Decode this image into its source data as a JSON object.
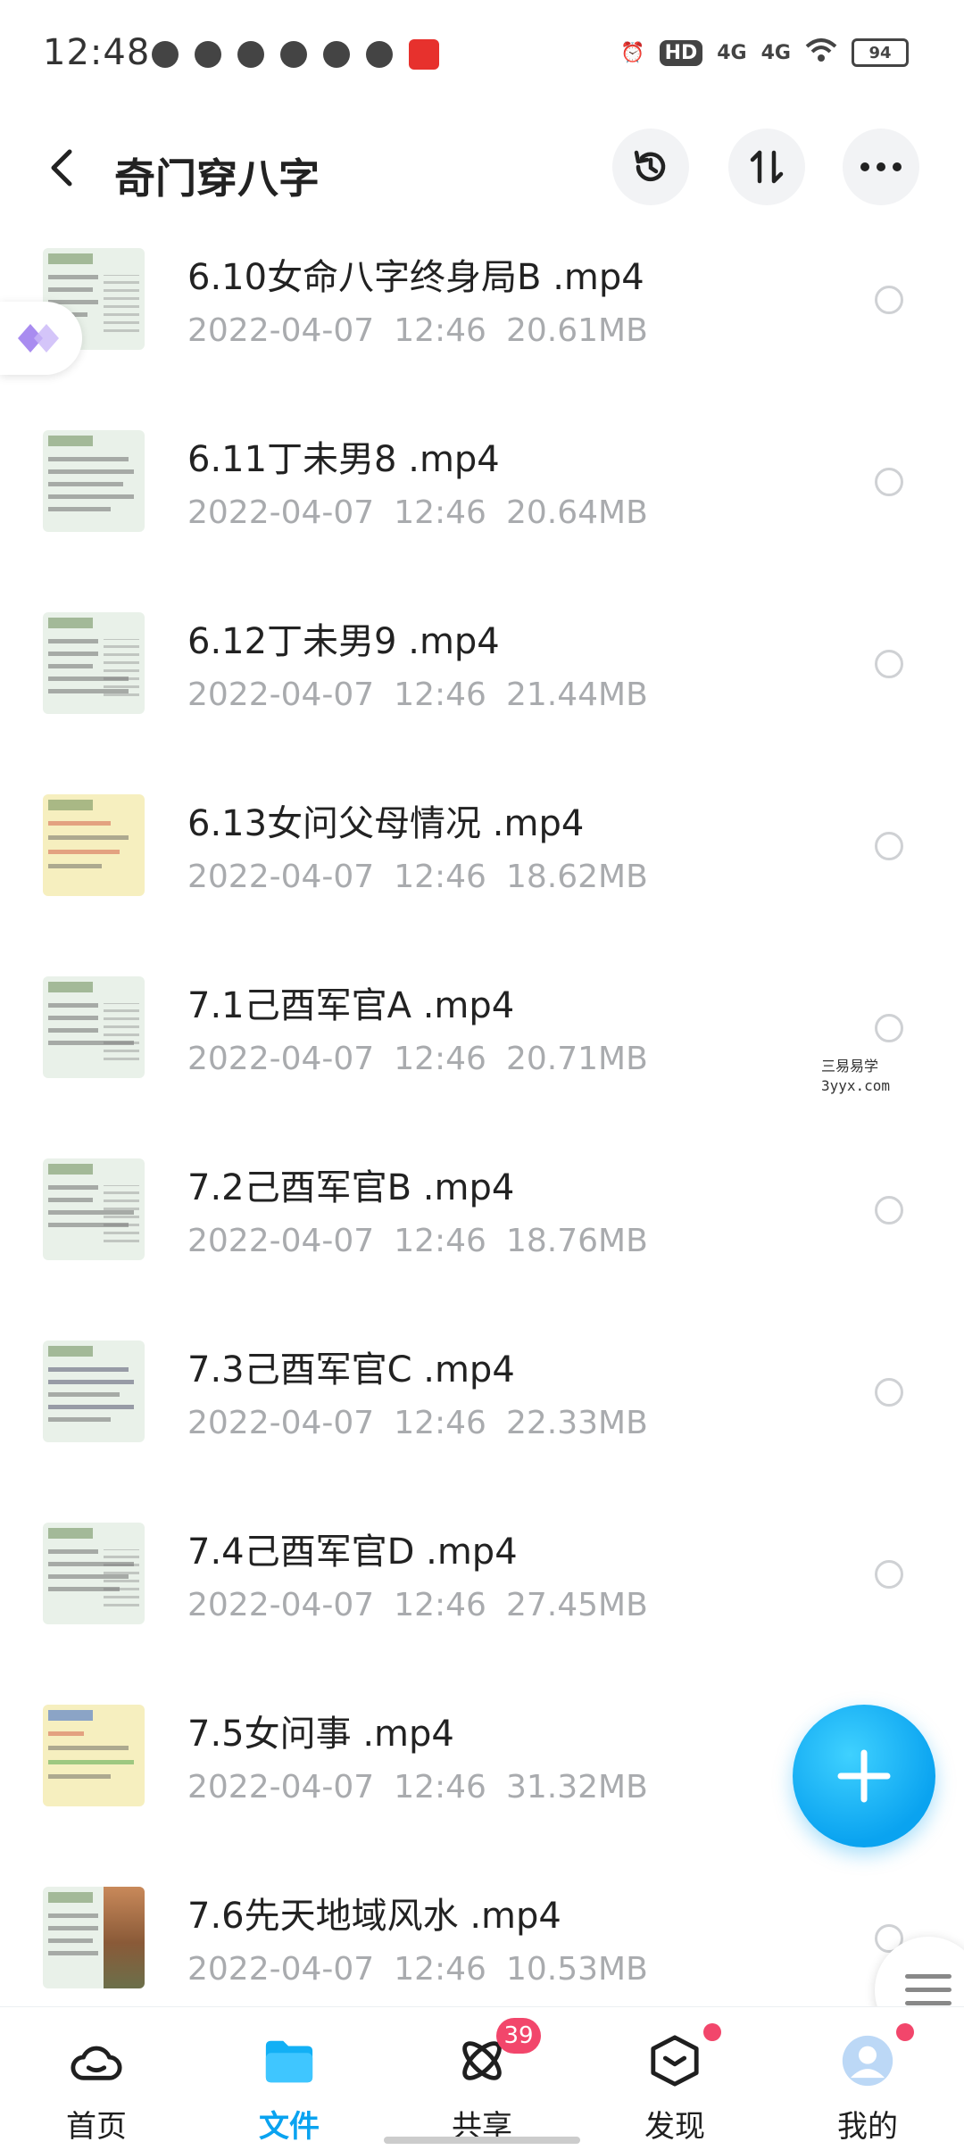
{
  "status_bar": {
    "time": "12:48",
    "hd_label": "HD",
    "network_1": "4G",
    "network_2": "4G",
    "battery": "94"
  },
  "header": {
    "title": "奇门穿八字"
  },
  "files": [
    {
      "name": "6.10女命八字终身局B .mp4",
      "date": "2022-04-07",
      "time": "12:46",
      "size": "20.61MB",
      "thumb": "green"
    },
    {
      "name": "6.11丁未男8 .mp4",
      "date": "2022-04-07",
      "time": "12:46",
      "size": "20.64MB",
      "thumb": "green"
    },
    {
      "name": "6.12丁未男9 .mp4",
      "date": "2022-04-07",
      "time": "12:46",
      "size": "21.44MB",
      "thumb": "green"
    },
    {
      "name": "6.13女问父母情况 .mp4",
      "date": "2022-04-07",
      "time": "12:46",
      "size": "18.62MB",
      "thumb": "yellow"
    },
    {
      "name": "7.1己酉军官A .mp4",
      "date": "2022-04-07",
      "time": "12:46",
      "size": "20.71MB",
      "thumb": "green"
    },
    {
      "name": "7.2己酉军官B .mp4",
      "date": "2022-04-07",
      "time": "12:46",
      "size": "18.76MB",
      "thumb": "green"
    },
    {
      "name": "7.3己酉军官C .mp4",
      "date": "2022-04-07",
      "time": "12:46",
      "size": "22.33MB",
      "thumb": "green"
    },
    {
      "name": "7.4己酉军官D .mp4",
      "date": "2022-04-07",
      "time": "12:46",
      "size": "27.45MB",
      "thumb": "green"
    },
    {
      "name": "7.5女问事 .mp4",
      "date": "2022-04-07",
      "time": "12:46",
      "size": "31.32MB",
      "thumb": "yellow"
    },
    {
      "name": "7.6先天地域风水 .mp4",
      "date": "2022-04-07",
      "time": "12:46",
      "size": "10.53MB",
      "thumb": "photo"
    }
  ],
  "watermark": {
    "line1": "三易易学",
    "line2": "3yyx.com"
  },
  "bottom_nav": [
    {
      "label": "首页",
      "icon": "cloud-home-icon"
    },
    {
      "label": "文件",
      "icon": "folder-icon",
      "active": true
    },
    {
      "label": "共享",
      "icon": "share-atom-icon",
      "badge": "39"
    },
    {
      "label": "发现",
      "icon": "discover-cube-icon",
      "dot": true
    },
    {
      "label": "我的",
      "icon": "avatar-icon",
      "dot": true
    }
  ],
  "colors": {
    "accent": "#0aa3f0",
    "badge": "#f2466b",
    "meta_text": "#a9abae"
  }
}
